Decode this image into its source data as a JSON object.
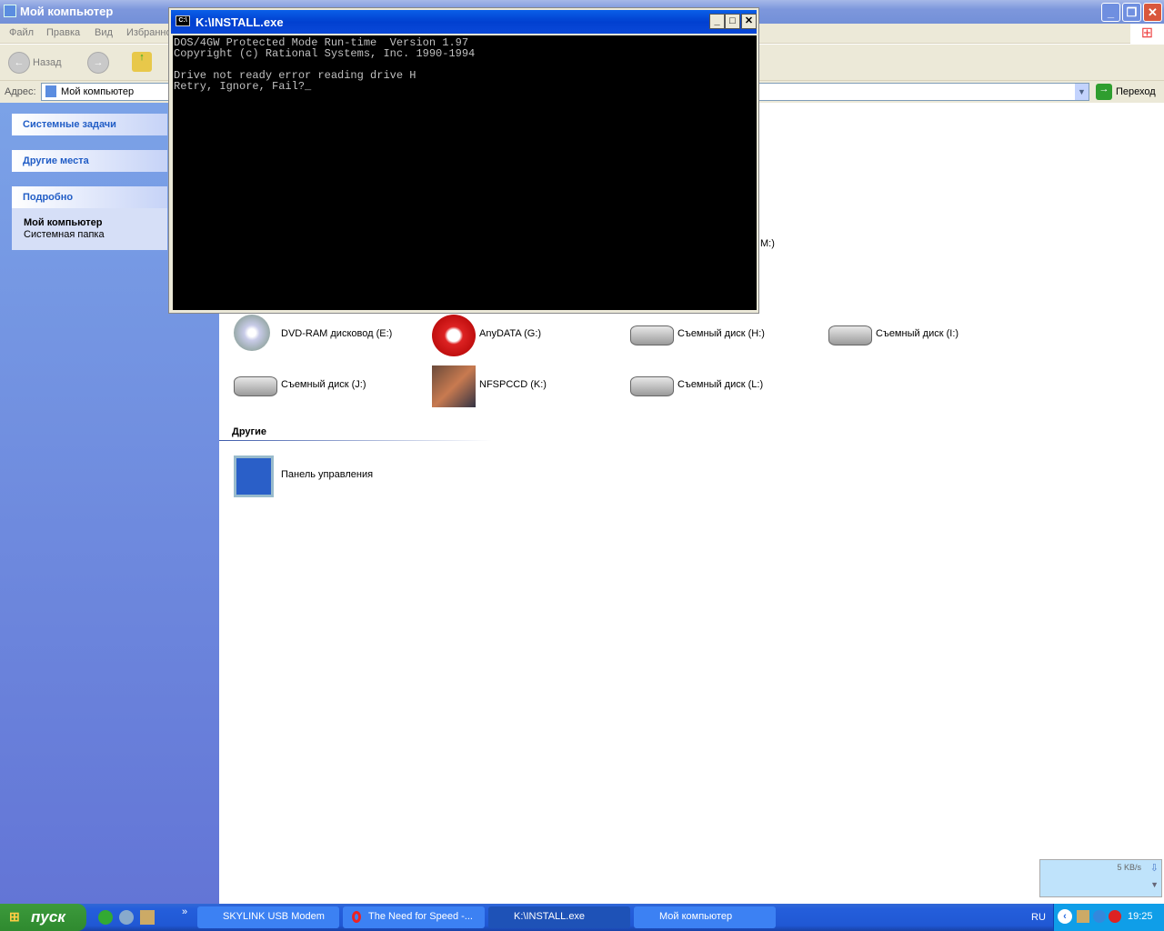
{
  "explorer": {
    "title": "Мой компьютер",
    "menu": [
      "Файл",
      "Правка",
      "Вид",
      "Избранное"
    ],
    "toolbar": {
      "back": "Назад"
    },
    "address": {
      "label": "Адрес:",
      "value": "Мой компьютер",
      "go": "Переход"
    },
    "left_pane": {
      "system_tasks": "Системные задачи",
      "other_places": "Другие места",
      "details": {
        "header": "Подробно",
        "name": "Мой компьютер",
        "type": "Системная папка"
      }
    },
    "partial_label": "M:)",
    "drives": [
      {
        "label": "DVD-RAM дисковод (E:)",
        "icon": "dvd-drive"
      },
      {
        "label": "AnyDATA (G:)",
        "icon": "anydata"
      },
      {
        "label": "Съемный диск (H:)",
        "icon": "removable-disk"
      },
      {
        "label": "Съемный диск (I:)",
        "icon": "removable-disk"
      },
      {
        "label": "Съемный диск (J:)",
        "icon": "removable-disk"
      },
      {
        "label": "NFSPCCD (K:)",
        "icon": "cd-image"
      },
      {
        "label": "Съемный диск (L:)",
        "icon": "removable-disk"
      }
    ],
    "other_section": {
      "header": "Другие",
      "items": [
        {
          "label": "Панель управления"
        }
      ]
    }
  },
  "console": {
    "title": "K:\\INSTALL.exe",
    "lines": [
      "DOS/4GW Protected Mode Run-time  Version 1.97",
      "Copyright (c) Rational Systems, Inc. 1990-1994",
      "",
      "Drive not ready error reading drive H",
      "Retry, Ignore, Fail?_"
    ]
  },
  "network_widget": {
    "speed": "5 KB/s"
  },
  "taskbar": {
    "start": "пуск",
    "tasks": [
      {
        "label": "SKYLINK USB Modem"
      },
      {
        "label": "The Need for Speed -..."
      },
      {
        "label": "K:\\INSTALL.exe",
        "active": true
      },
      {
        "label": "Мой компьютер"
      }
    ],
    "lang": "RU",
    "clock": "19:25"
  }
}
